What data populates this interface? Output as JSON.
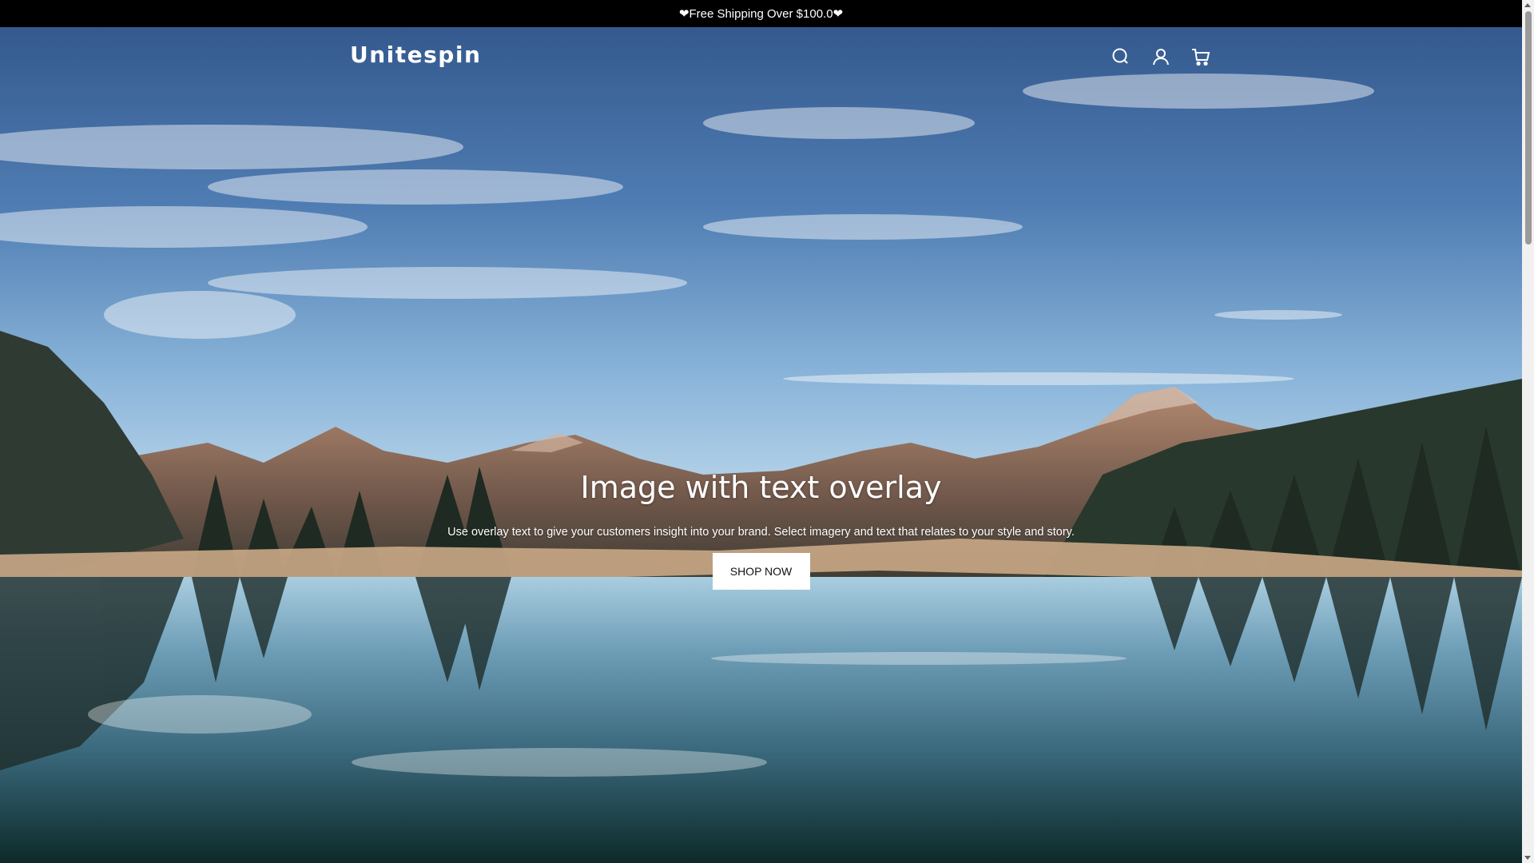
{
  "announcement": {
    "text": "❤Free Shipping Over $100.0❤"
  },
  "header": {
    "logo": "Unitespin",
    "icons": [
      "search-icon",
      "account-icon",
      "cart-icon"
    ]
  },
  "hero": {
    "heading": "Image with text overlay",
    "subheading": "Use overlay text to give your customers insight into your brand. Select imagery and text that relates to your style and story.",
    "button_label": "SHOP NOW"
  },
  "colors": {
    "announcement_bg": "#000000",
    "button_bg": "#ffffff",
    "text_light": "#ffffff"
  }
}
